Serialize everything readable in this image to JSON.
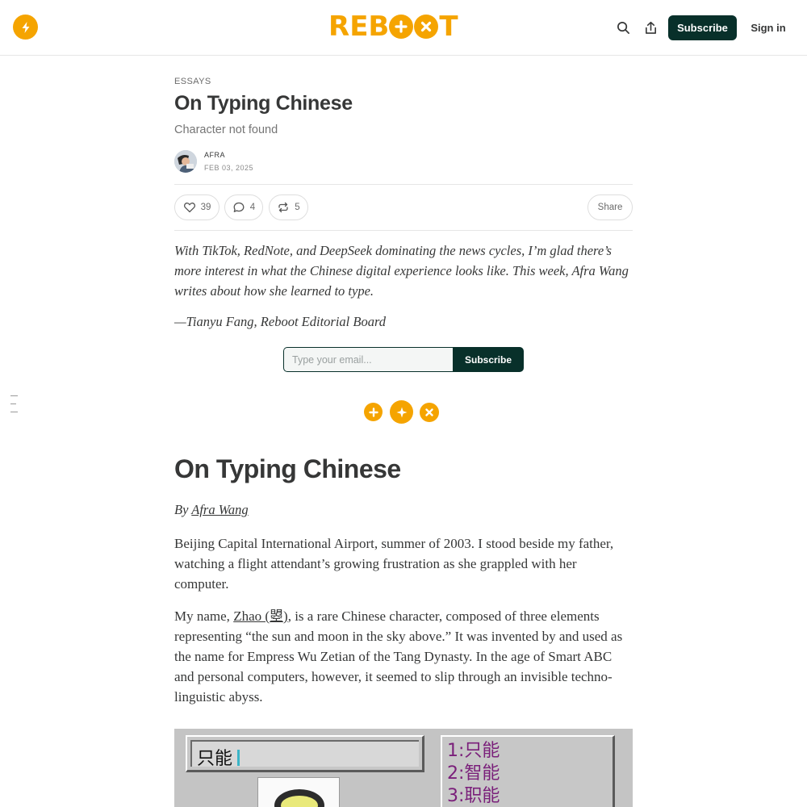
{
  "nav": {
    "publication_logo_icon": "bolt-icon",
    "wordmark": "REBOOT",
    "search_icon": "search-icon",
    "share_icon": "share-icon",
    "subscribe_label": "Subscribe",
    "signin_label": "Sign in"
  },
  "colors": {
    "brand": "#F5A400",
    "accent_dark": "#08302a",
    "text": "#363737"
  },
  "post": {
    "section": "ESSAYS",
    "title": "On Typing Chinese",
    "subtitle": "Character not found",
    "author": "AFRA",
    "date": "FEB 03, 2025",
    "likes": "39",
    "comments": "4",
    "restacks": "5",
    "share_label": "Share"
  },
  "editor_note": {
    "text": "With TikTok, RedNote, and DeepSeek dominating the news cycles, I’m glad there’s more interest in what the Chinese digital experience looks like. This week, Afra Wang writes about how she learned to type.",
    "signoff": "—Tianyu Fang, Reboot Editorial Board"
  },
  "subscribe_form": {
    "email_placeholder": "Type your email...",
    "button_label": "Subscribe"
  },
  "article": {
    "title": "On Typing Chinese",
    "byline_prefix": "By ",
    "byline_author": "Afra Wang",
    "p1": "Beijing Capital International Airport, summer of 2003. I stood beside my father, watching a flight attendant’s growing frustration as she grappled with her computer.",
    "p2_before": "My name, ",
    "p2_link": "Zhao (曌)",
    "p2_after": ", is a rare Chinese character, composed of three elements representing “the sun and moon in the sky above.” It was invented by and used as the name for Empress Wu Zetian of the Tang Dynasty. In the age of Smart ABC and personal computers, however, it seemed to slip through an invisible techno-linguistic abyss."
  },
  "figure": {
    "input_text": "只能",
    "candidates": [
      "1:只能",
      "2:智能",
      "3:职能"
    ]
  }
}
